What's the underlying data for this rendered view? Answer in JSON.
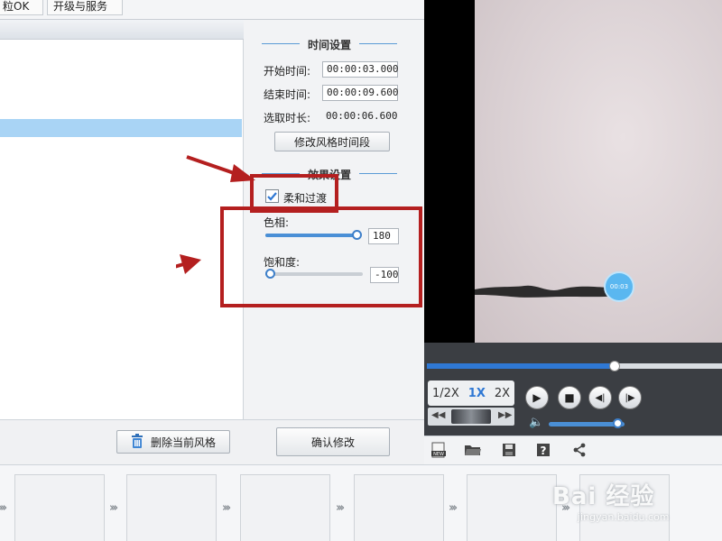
{
  "tabs": [
    {
      "label": "粒OK"
    },
    {
      "label": "开级与服务"
    }
  ],
  "left_panel": {
    "delete_button_label": "删除当前风格"
  },
  "time_settings": {
    "section_title": "时间设置",
    "start_label": "开始时间:",
    "start_value": "00:00:03.000",
    "end_label": "结束时间:",
    "end_value": "00:00:09.600",
    "duration_label": "选取时长:",
    "duration_value": "00:00:06.600",
    "modify_button_label": "修改风格时间段"
  },
  "effect_settings": {
    "section_title": "效果设置",
    "soft_transition_label": "柔和过渡",
    "soft_transition_checked": true,
    "hue_label": "色相:",
    "hue_value": "180",
    "hue_fraction": 0.98,
    "saturation_label": "饱和度:",
    "saturation_value": "-100",
    "saturation_fraction": 0.0
  },
  "confirm_button_label": "确认修改",
  "player": {
    "bubble_text": "00:03",
    "speeds": [
      "1/2X",
      "1X",
      "2X"
    ],
    "active_speed": "1X",
    "progress_fraction": 0.635,
    "volume_fraction": 0.92
  },
  "watermark": {
    "logo_text": "Bai 经验",
    "url": "jingyan.baidu.com"
  },
  "colors": {
    "accent": "#4a8fd6",
    "annotation_red": "#b41f1f",
    "list_selection": "#a9d4f5"
  }
}
